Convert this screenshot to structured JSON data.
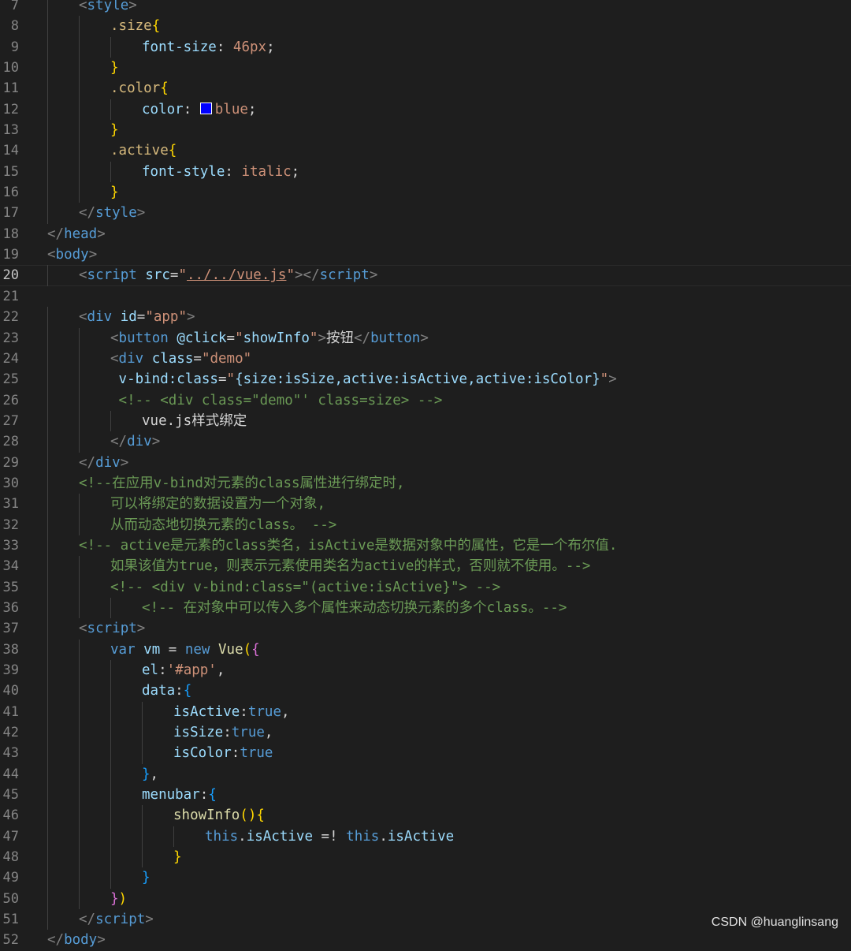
{
  "editor": {
    "lines": [
      {
        "n": "7",
        "code": [
          {
            "t": "<",
            "c": "punc"
          },
          {
            "t": "style",
            "c": "tag"
          },
          {
            "t": ">",
            "c": "punc"
          }
        ],
        "indent": 2
      },
      {
        "n": "8",
        "code": [
          {
            "t": ".size",
            "c": "sel"
          },
          {
            "t": "{",
            "c": "brace"
          }
        ],
        "indent": 4
      },
      {
        "n": "9",
        "code": [
          {
            "t": "font-size",
            "c": "prop"
          },
          {
            "t": ": ",
            "c": "text"
          },
          {
            "t": "46px",
            "c": "val"
          },
          {
            "t": ";",
            "c": "text"
          }
        ],
        "indent": 6
      },
      {
        "n": "10",
        "code": [
          {
            "t": "}",
            "c": "brace"
          }
        ],
        "indent": 4
      },
      {
        "n": "11",
        "code": [
          {
            "t": ".color",
            "c": "sel"
          },
          {
            "t": "{",
            "c": "brace"
          }
        ],
        "indent": 4
      },
      {
        "n": "12",
        "code": [
          {
            "t": "color",
            "c": "prop"
          },
          {
            "t": ": ",
            "c": "text"
          },
          {
            "t": "",
            "c": "swatch"
          },
          {
            "t": "blue",
            "c": "val"
          },
          {
            "t": ";",
            "c": "text"
          }
        ],
        "indent": 6
      },
      {
        "n": "13",
        "code": [
          {
            "t": "}",
            "c": "brace"
          }
        ],
        "indent": 4
      },
      {
        "n": "14",
        "code": [
          {
            "t": ".active",
            "c": "sel"
          },
          {
            "t": "{",
            "c": "brace"
          }
        ],
        "indent": 4
      },
      {
        "n": "15",
        "code": [
          {
            "t": "font-style",
            "c": "prop"
          },
          {
            "t": ": ",
            "c": "text"
          },
          {
            "t": "italic",
            "c": "val"
          },
          {
            "t": ";",
            "c": "text"
          }
        ],
        "indent": 6
      },
      {
        "n": "16",
        "code": [
          {
            "t": "}",
            "c": "brace"
          }
        ],
        "indent": 4
      },
      {
        "n": "17",
        "code": [
          {
            "t": "</",
            "c": "punc"
          },
          {
            "t": "style",
            "c": "tag"
          },
          {
            "t": ">",
            "c": "punc"
          }
        ],
        "indent": 2
      },
      {
        "n": "18",
        "code": [
          {
            "t": "</",
            "c": "punc"
          },
          {
            "t": "head",
            "c": "tag"
          },
          {
            "t": ">",
            "c": "punc"
          }
        ],
        "indent": 0
      },
      {
        "n": "19",
        "code": [
          {
            "t": "<",
            "c": "punc"
          },
          {
            "t": "body",
            "c": "tag"
          },
          {
            "t": ">",
            "c": "punc"
          }
        ],
        "indent": 0
      },
      {
        "n": "20",
        "code": [
          {
            "t": "<",
            "c": "punc"
          },
          {
            "t": "script",
            "c": "tag"
          },
          {
            "t": " ",
            "c": "text"
          },
          {
            "t": "src",
            "c": "attr"
          },
          {
            "t": "=",
            "c": "text"
          },
          {
            "t": "\"",
            "c": "str"
          },
          {
            "t": "../../vue.js",
            "c": "strul"
          },
          {
            "t": "\"",
            "c": "str"
          },
          {
            "t": "></",
            "c": "punc"
          },
          {
            "t": "script",
            "c": "tag"
          },
          {
            "t": ">",
            "c": "punc"
          }
        ],
        "indent": 2,
        "current": true
      },
      {
        "n": "21",
        "code": [],
        "indent": 0
      },
      {
        "n": "22",
        "code": [
          {
            "t": "<",
            "c": "punc"
          },
          {
            "t": "div",
            "c": "tag"
          },
          {
            "t": " ",
            "c": "text"
          },
          {
            "t": "id",
            "c": "attr"
          },
          {
            "t": "=",
            "c": "text"
          },
          {
            "t": "\"app\"",
            "c": "str"
          },
          {
            "t": ">",
            "c": "punc"
          }
        ],
        "indent": 2
      },
      {
        "n": "23",
        "code": [
          {
            "t": "<",
            "c": "punc"
          },
          {
            "t": "button",
            "c": "tag"
          },
          {
            "t": " ",
            "c": "text"
          },
          {
            "t": "@click",
            "c": "attr"
          },
          {
            "t": "=",
            "c": "text"
          },
          {
            "t": "\"",
            "c": "str"
          },
          {
            "t": "showInfo",
            "c": "var"
          },
          {
            "t": "\"",
            "c": "str"
          },
          {
            "t": ">",
            "c": "punc"
          },
          {
            "t": "按钮",
            "c": "text"
          },
          {
            "t": "</",
            "c": "punc"
          },
          {
            "t": "button",
            "c": "tag"
          },
          {
            "t": ">",
            "c": "punc"
          }
        ],
        "indent": 4
      },
      {
        "n": "24",
        "code": [
          {
            "t": "<",
            "c": "punc"
          },
          {
            "t": "div",
            "c": "tag"
          },
          {
            "t": " ",
            "c": "text"
          },
          {
            "t": "class",
            "c": "attr"
          },
          {
            "t": "=",
            "c": "text"
          },
          {
            "t": "\"demo\"",
            "c": "str"
          }
        ],
        "indent": 4
      },
      {
        "n": "25",
        "code": [
          {
            "t": " v-bind:class",
            "c": "attr"
          },
          {
            "t": "=",
            "c": "text"
          },
          {
            "t": "\"",
            "c": "str"
          },
          {
            "t": "{size:isSize,active:isActive,active:isColor}",
            "c": "var"
          },
          {
            "t": "\"",
            "c": "str"
          },
          {
            "t": ">",
            "c": "punc"
          }
        ],
        "indent": 4
      },
      {
        "n": "26",
        "code": [
          {
            "t": " <!-- <div class=\"demo\"' class=size> -->",
            "c": "cmt"
          }
        ],
        "indent": 4
      },
      {
        "n": "27",
        "code": [
          {
            "t": "vue.js样式绑定",
            "c": "text"
          }
        ],
        "indent": 6
      },
      {
        "n": "28",
        "code": [
          {
            "t": "</",
            "c": "punc"
          },
          {
            "t": "div",
            "c": "tag"
          },
          {
            "t": ">",
            "c": "punc"
          }
        ],
        "indent": 4
      },
      {
        "n": "29",
        "code": [
          {
            "t": "</",
            "c": "punc"
          },
          {
            "t": "div",
            "c": "tag"
          },
          {
            "t": ">",
            "c": "punc"
          }
        ],
        "indent": 2
      },
      {
        "n": "30",
        "code": [
          {
            "t": "<!--在应用v-bind对元素的class属性进行绑定时,",
            "c": "cmt"
          }
        ],
        "indent": 2
      },
      {
        "n": "31",
        "code": [
          {
            "t": "可以将绑定的数据设置为一个对象,",
            "c": "cmt"
          }
        ],
        "indent": 4
      },
      {
        "n": "32",
        "code": [
          {
            "t": "从而动态地切换元素的class。 -->",
            "c": "cmt"
          }
        ],
        "indent": 4
      },
      {
        "n": "33",
        "code": [
          {
            "t": "<!-- active是元素的class类名，isActive是数据对象中的属性，它是一个布尔值.",
            "c": "cmt"
          }
        ],
        "indent": 2
      },
      {
        "n": "34",
        "code": [
          {
            "t": "如果该值为true，则表示元素使用类名为active的样式，否则就不使用。-->",
            "c": "cmt"
          }
        ],
        "indent": 4
      },
      {
        "n": "35",
        "code": [
          {
            "t": "<!-- <div v-bind:class=\"(active:isActive}\"> -->",
            "c": "cmt"
          }
        ],
        "indent": 4
      },
      {
        "n": "36",
        "code": [
          {
            "t": "<!-- 在对象中可以传入多个属性来动态切换元素的多个class。-->",
            "c": "cmt"
          }
        ],
        "indent": 6
      },
      {
        "n": "37",
        "code": [
          {
            "t": "<",
            "c": "punc"
          },
          {
            "t": "script",
            "c": "tag"
          },
          {
            "t": ">",
            "c": "punc"
          }
        ],
        "indent": 2
      },
      {
        "n": "38",
        "code": [
          {
            "t": "var",
            "c": "kw"
          },
          {
            "t": " ",
            "c": "text"
          },
          {
            "t": "vm",
            "c": "var"
          },
          {
            "t": " = ",
            "c": "text"
          },
          {
            "t": "new",
            "c": "kw"
          },
          {
            "t": " ",
            "c": "text"
          },
          {
            "t": "Vue",
            "c": "fn"
          },
          {
            "t": "(",
            "c": "brace"
          },
          {
            "t": "{",
            "c": "brace2"
          }
        ],
        "indent": 4
      },
      {
        "n": "39",
        "code": [
          {
            "t": "el",
            "c": "var"
          },
          {
            "t": ":",
            "c": "text"
          },
          {
            "t": "'#app'",
            "c": "str"
          },
          {
            "t": ",",
            "c": "text"
          }
        ],
        "indent": 6
      },
      {
        "n": "40",
        "code": [
          {
            "t": "data",
            "c": "var"
          },
          {
            "t": ":",
            "c": "text"
          },
          {
            "t": "{",
            "c": "brace3"
          }
        ],
        "indent": 6
      },
      {
        "n": "41",
        "code": [
          {
            "t": "isActive",
            "c": "var"
          },
          {
            "t": ":",
            "c": "text"
          },
          {
            "t": "true",
            "c": "kw"
          },
          {
            "t": ",",
            "c": "text"
          }
        ],
        "indent": 8
      },
      {
        "n": "42",
        "code": [
          {
            "t": "isSize",
            "c": "var"
          },
          {
            "t": ":",
            "c": "text"
          },
          {
            "t": "true",
            "c": "kw"
          },
          {
            "t": ",",
            "c": "text"
          }
        ],
        "indent": 8
      },
      {
        "n": "43",
        "code": [
          {
            "t": "isColor",
            "c": "var"
          },
          {
            "t": ":",
            "c": "text"
          },
          {
            "t": "true",
            "c": "kw"
          }
        ],
        "indent": 8
      },
      {
        "n": "44",
        "code": [
          {
            "t": "}",
            "c": "brace3"
          },
          {
            "t": ",",
            "c": "text"
          }
        ],
        "indent": 6
      },
      {
        "n": "45",
        "code": [
          {
            "t": "menubar",
            "c": "var"
          },
          {
            "t": ":",
            "c": "text"
          },
          {
            "t": "{",
            "c": "brace3"
          }
        ],
        "indent": 6
      },
      {
        "n": "46",
        "code": [
          {
            "t": "showInfo",
            "c": "fn"
          },
          {
            "t": "()",
            "c": "brace"
          },
          {
            "t": "{",
            "c": "brace"
          }
        ],
        "indent": 8
      },
      {
        "n": "47",
        "code": [
          {
            "t": "this",
            "c": "kw"
          },
          {
            "t": ".",
            "c": "text"
          },
          {
            "t": "isActive",
            "c": "var"
          },
          {
            "t": " =! ",
            "c": "text"
          },
          {
            "t": "this",
            "c": "kw"
          },
          {
            "t": ".",
            "c": "text"
          },
          {
            "t": "isActive",
            "c": "var"
          }
        ],
        "indent": 10
      },
      {
        "n": "48",
        "code": [
          {
            "t": "}",
            "c": "brace"
          }
        ],
        "indent": 8
      },
      {
        "n": "49",
        "code": [
          {
            "t": "}",
            "c": "brace3"
          }
        ],
        "indent": 6
      },
      {
        "n": "50",
        "code": [
          {
            "t": "}",
            "c": "brace2"
          },
          {
            "t": ")",
            "c": "brace"
          }
        ],
        "indent": 4
      },
      {
        "n": "51",
        "code": [
          {
            "t": "</",
            "c": "punc"
          },
          {
            "t": "script",
            "c": "tag"
          },
          {
            "t": ">",
            "c": "punc"
          }
        ],
        "indent": 2
      },
      {
        "n": "52",
        "code": [
          {
            "t": "</",
            "c": "punc"
          },
          {
            "t": "body",
            "c": "tag"
          },
          {
            "t": ">",
            "c": "punc"
          }
        ],
        "indent": 0
      }
    ]
  },
  "watermark": "CSDN @huanglinsang",
  "colors": {
    "background": "#1e1e1e",
    "tag": "#569cd6",
    "attribute": "#9cdcfe",
    "string": "#ce9178",
    "comment": "#6a9955",
    "selector": "#d7ba7d",
    "swatch_blue": "#0000ff"
  }
}
